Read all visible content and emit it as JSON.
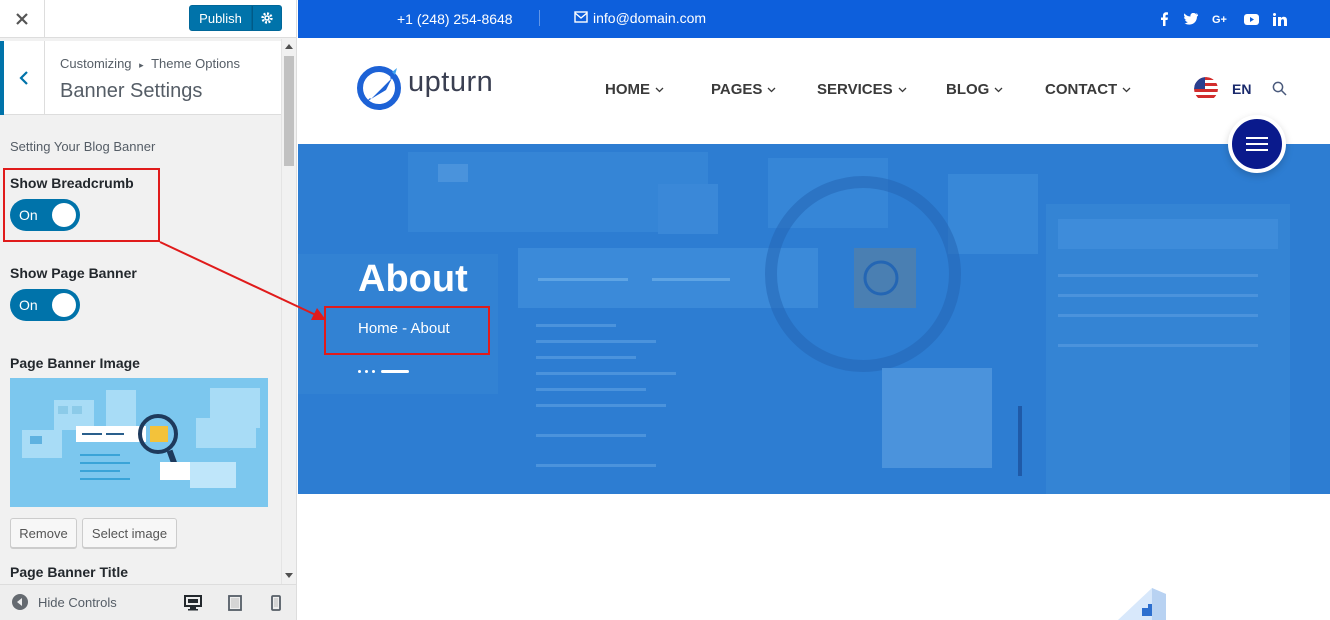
{
  "customizer": {
    "close_icon": "close-icon",
    "publish_label": "Publish",
    "gear_icon": "gear-icon",
    "breadcrumb_parent": "Customizing",
    "breadcrumb_sep": "▸",
    "breadcrumb_child": "Theme Options",
    "section_title": "Banner Settings",
    "section_desc": "Setting Your Blog Banner",
    "show_breadcrumb_label": "Show Breadcrumb",
    "show_breadcrumb_value": "On",
    "show_page_banner_label": "Show Page Banner",
    "show_page_banner_value": "On",
    "page_banner_image_label": "Page Banner Image",
    "remove_label": "Remove",
    "select_image_label": "Select image",
    "page_banner_title_label": "Page Banner Title",
    "hide_controls_label": "Hide Controls",
    "accent": "#0073aa"
  },
  "site": {
    "topbar": {
      "phone": "+1 (248) 254-8648",
      "email": "info@domain.com",
      "social": [
        "f",
        "t",
        "g+",
        "yt",
        "in"
      ],
      "bg": "#0d5fdc"
    },
    "logo_text": "upturn",
    "nav": [
      "HOME",
      "PAGES",
      "SERVICES",
      "BLOG",
      "CONTACT"
    ],
    "lang": "EN",
    "banner": {
      "title": "About",
      "breadcrumb": "Home - About",
      "bg": "#2d7dd2"
    }
  }
}
